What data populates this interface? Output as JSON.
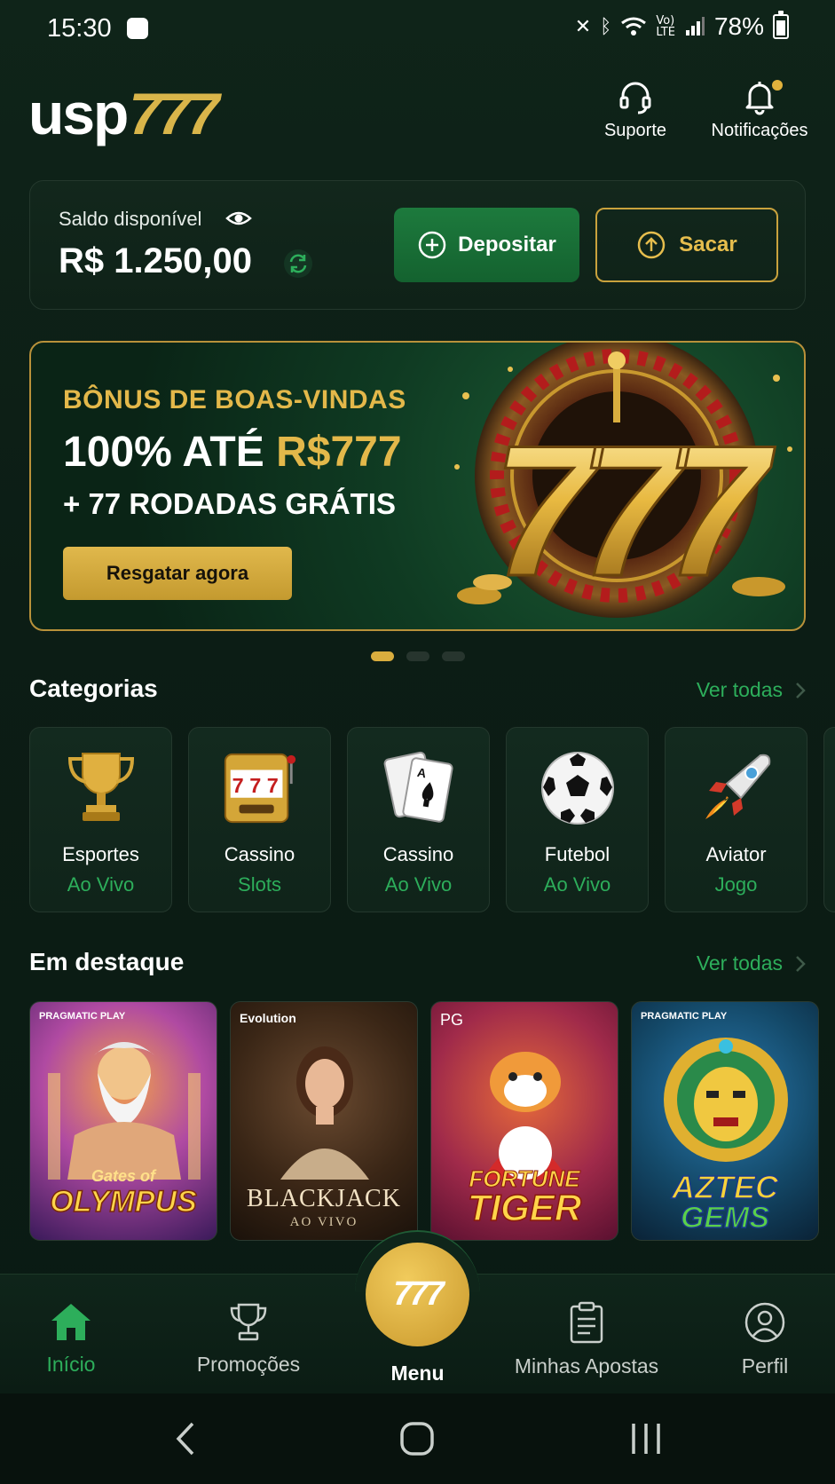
{
  "status_bar": {
    "time": "15:30",
    "battery": "78%"
  },
  "header": {
    "logo_text_1": "usp",
    "logo_text_2": "777",
    "support_label": "Suporte",
    "notifications_label": "Notificações"
  },
  "balance": {
    "label": "Saldo disponível",
    "value": "R$ 1.250,00",
    "deposit_label": "Depositar",
    "withdraw_label": "Sacar"
  },
  "banner": {
    "subtitle": "BÔNUS DE BOAS-VINDAS",
    "title_part1": "100% ATÉ ",
    "title_part2": "R$777",
    "line3": "+ 77 RODADAS GRÁTIS",
    "cta": "Resgatar agora",
    "art_text": "777"
  },
  "categories": {
    "title": "Categorias",
    "see_all": "Ver todas",
    "items": [
      {
        "line1": "Esportes",
        "line2": "Ao Vivo",
        "icon": "trophy-icon"
      },
      {
        "line1": "Cassino",
        "line2": "Slots",
        "icon": "slot-machine-icon"
      },
      {
        "line1": "Cassino",
        "line2": "Ao Vivo",
        "icon": "playing-cards-icon"
      },
      {
        "line1": "Futebol",
        "line2": "Ao Vivo",
        "icon": "soccer-ball-icon"
      },
      {
        "line1": "Aviator",
        "line2": "Jogo",
        "icon": "rocket-icon"
      }
    ]
  },
  "featured": {
    "title": "Em destaque",
    "see_all": "Ver todas",
    "games": [
      {
        "provider": "PRAGMATIC PLAY",
        "title_top": "Gates of",
        "title": "OLYMPUS"
      },
      {
        "provider": "Evolution",
        "title": "BLACKJACK",
        "subtitle": "AO VIVO"
      },
      {
        "provider": "PG",
        "title_top": "FORTUNE",
        "title": "TIGER"
      },
      {
        "provider": "PRAGMATIC PLAY",
        "title_top": "AZTEC",
        "title": "GEMS"
      }
    ]
  },
  "bottom_nav": {
    "home": "Início",
    "promotions": "Promoções",
    "menu": "Menu",
    "menu_logo": "777",
    "my_bets": "Minhas Apostas",
    "profile": "Perfil"
  },
  "colors": {
    "accent_green": "#2dae5b",
    "gold": "#e3b84a",
    "background": "#0d1e17"
  }
}
